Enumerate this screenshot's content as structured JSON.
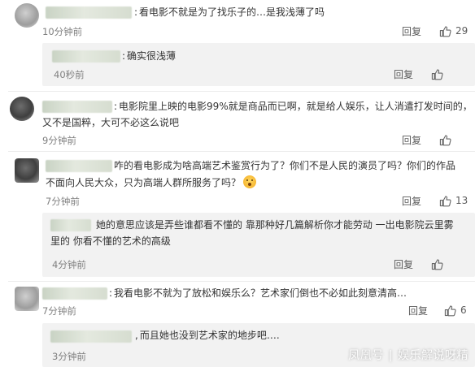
{
  "comments": [
    {
      "text": "看电影不就是为了找乐子的…是我浅薄了吗",
      "time": "10分钟前",
      "reply": "回复",
      "likes": "29",
      "replies": [
        {
          "text": "确实很浅薄",
          "time": "40秒前",
          "reply": "回复",
          "likes": ""
        }
      ]
    },
    {
      "text_line1": "电影院里上映的电影99%就是商品而已啊，就是给人娱乐，让人消遣打发时间的，",
      "text_line2": "又不是国粹，大可不必这么说吧",
      "time": "9分钟前",
      "reply": "回复",
      "likes": ""
    },
    {
      "text_line1": "咋的看电影成为啥高端艺术鉴赏行为了？你们不是人民的演员了吗？你们的作品",
      "text_line2": "不面向人民大众，只为高端人群所服务了吗？",
      "time": "7分钟前",
      "reply": "回复",
      "likes": "13",
      "replies": [
        {
          "text_line1": "她的意思应该是弄些谁都看不懂的 靠那种好几篇解析你才能劳动 一出电影院云里雾",
          "text_line2": "里的 你看不懂的艺术的高级",
          "time": "4分钟前",
          "reply": "回复",
          "likes": ""
        }
      ]
    },
    {
      "text": "我看电影不就为了放松和娱乐么？艺术家们倒也不必如此刻意清高…",
      "time": "7分钟前",
      "reply": "回复",
      "likes": "6",
      "replies": [
        {
          "text": "而且她也没到艺术家的地步吧….",
          "time": "3分钟前",
          "reply": "回复",
          "likes": ""
        }
      ]
    }
  ],
  "watermark": {
    "brand": "凤凰号",
    "author": "娱乐解说呀精"
  },
  "colors": {
    "text": "#333333",
    "meta": "#808080",
    "reply_bg": "#f2f2f2"
  },
  "icons": {
    "like": "thumbs-up-icon"
  }
}
